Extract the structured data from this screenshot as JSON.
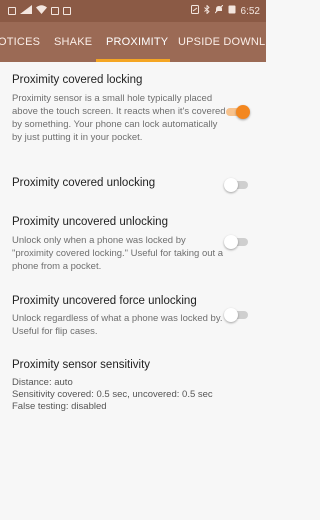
{
  "status_bar": {
    "time": "6:52",
    "left_icons": [
      "sim-icon",
      "signal-icon",
      "wifi-icon",
      "image-icon",
      "notification-icon"
    ],
    "right_icons": [
      "nfc-icon",
      "bluetooth-icon",
      "mute-icon",
      "battery-icon"
    ]
  },
  "tabs": [
    {
      "label": "OTICES"
    },
    {
      "label": "SHAKE"
    },
    {
      "label": "PROXIMITY",
      "active": true
    },
    {
      "label": "UPSIDE DOWN"
    },
    {
      "label": "L"
    }
  ],
  "accent_color": "#f3871f",
  "tab_indicator_color": "#f5a623",
  "settings": [
    {
      "title": "Proximity covered locking",
      "summary": "Proximity sensor is a small hole typically placed above the touch screen. It reacts when it's covered by something. Your phone can lock automatically by just putting it in your pocket.",
      "enabled": true
    },
    {
      "title": "Proximity covered unlocking",
      "summary": "",
      "enabled": false
    },
    {
      "title": "Proximity uncovered unlocking",
      "summary": "Unlock only when a phone was locked by \"proximity covered locking.\" Useful for taking out a phone from a pocket.",
      "enabled": false
    },
    {
      "title": "Proximity uncovered force unlocking",
      "summary": "Unlock regardless of what a phone was locked by. Useful for flip cases.",
      "enabled": false
    }
  ],
  "sensitivity": {
    "title": "Proximity sensor sensitivity",
    "lines": [
      "Distance: auto",
      "Sensitivity covered: 0.5 sec, uncovered: 0.5 sec",
      "False testing: disabled"
    ]
  }
}
